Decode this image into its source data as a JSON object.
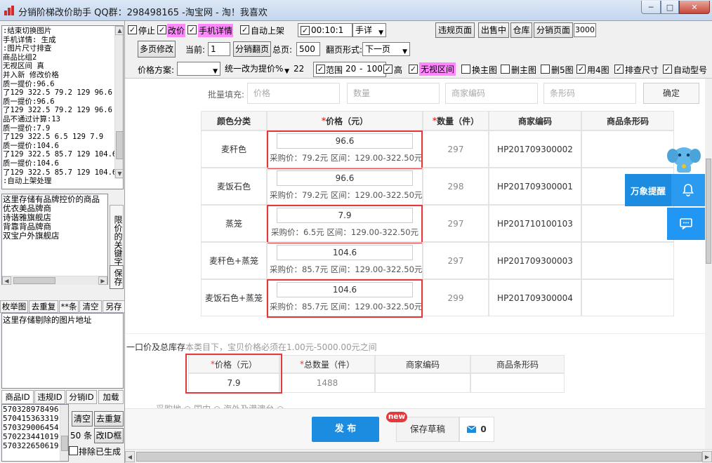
{
  "window": {
    "title": "分销阶梯改价助手 QQ群：298498165 -淘宝网 - 淘！我喜欢",
    "min": "─",
    "max": "□",
    "close": "✕"
  },
  "colors": {
    "accent_blue": "#2196f3",
    "pink": "#ff88ff",
    "red": "#e4393c"
  },
  "left": {
    "log_lines": [
      ":结束切换图片",
      "手机详情: 生成",
      ":图片尺寸排查",
      "商品比组2",
      "无视区间 真",
      "并入新 修改价格",
      "质一提价:96.6",
      "了129 322.5 79.2 129 96.6",
      "质一提价:96.6",
      "了129 322.5 79.2 129 96.6",
      "品不通过计算:13",
      "质一提价:7.9",
      "了129 322.5 6.5 129 7.9",
      "质一提价:104.6",
      "了129 322.5 85.7 129 104.6",
      "质一提价:104.6",
      "了129 322.5 85.7 129 104.6",
      ":自动上架处理"
    ],
    "keyword_lines": [
      "这里存储有品牌控价的商品",
      "优衣美品牌商",
      "诗谐雅旗舰店",
      "背靠背品牌商",
      "双宝户外旗舰店"
    ],
    "keyword_label": "限价的关键字",
    "save_label": "保存",
    "tabs1": [
      "枚举图",
      "去重复",
      "**条",
      "清空",
      "另存"
    ],
    "delpic_text": "这里存储剔除的图片地址",
    "tabs2": [
      "商品ID",
      "违规ID",
      "分销ID",
      "加载"
    ],
    "ids": [
      "570328978496",
      "570415363319",
      "570329006454",
      "570223441019",
      "570322650619"
    ],
    "clear_label": "清空",
    "dedupe_label": "去重复",
    "count_label": "50 条",
    "edit_id_label": "改ID框",
    "exclude_label": "排除已生成"
  },
  "toolbar1": {
    "stop": "停止",
    "change_price": "改价",
    "mobile_detail": "手机详情",
    "auto_list": "自动上架",
    "time_value": "00:10:1",
    "detail_mode": "手详",
    "violation_page": "违规页面",
    "sale_page": "出售中",
    "warehouse": "仓库",
    "distribution_page": "分销页面",
    "distribution_value": "3000"
  },
  "toolbar2": {
    "multi_edit": "多页修改",
    "current_label": "当前:",
    "current_value": "1",
    "distribution_flip": "分销翻页",
    "total_label": "总页:",
    "total_value": "500",
    "flip_label": "翻页形式:",
    "flip_value": "下一页"
  },
  "toolbar3": {
    "price_plan_label": "价格方案:",
    "price_plan_value": "",
    "unify_value": "统一改为提价%",
    "unify_number": "22",
    "range_label": "范围",
    "range_min": "20",
    "range_sep": "-",
    "range_max": "100",
    "high_label": "高",
    "ignore_range": "无视区间",
    "change_main": "换主图",
    "delete_main": "删主图",
    "delete_5": "删5图",
    "use_4": "用4图",
    "check_size": "排查尺寸",
    "auto_model": "自动型号"
  },
  "batch": {
    "label": "批量填充:",
    "price_ph": "价格",
    "qty_ph": "数量",
    "code_ph": "商家编码",
    "barcode_ph": "条形码",
    "confirm": "确定"
  },
  "sku_table": {
    "headers": {
      "color": "颜色分类",
      "price": "价格（元）",
      "qty": "数量（件）",
      "code": "商家编码",
      "barcode": "商品条形码"
    },
    "rows": [
      {
        "color": "麦秆色",
        "price": "96.6",
        "sub": "采购价：79.2元 区间：129.00-322.50元",
        "qty": "297",
        "code": "HP201709300002",
        "highlighted": true
      },
      {
        "color": "麦饭石色",
        "price": "96.6",
        "sub": "采购价：79.2元 区间：129.00-322.50元",
        "qty": "298",
        "code": "HP201709300001",
        "highlighted": false
      },
      {
        "color": "蒸笼",
        "price": "7.9",
        "sub": "采购价：6.5元 区间：129.00-322.50元",
        "qty": "297",
        "code": "HP201710100103",
        "highlighted": true
      },
      {
        "color": "麦秆色+蒸笼",
        "price": "104.6",
        "sub": "采购价：85.7元 区间：129.00-322.50元",
        "qty": "297",
        "code": "HP201709300003",
        "highlighted": false
      },
      {
        "color": "麦饭石色+蒸笼",
        "price": "104.6",
        "sub": "采购价：85.7元 区间：129.00-322.50元",
        "qty": "299",
        "code": "HP201709300004",
        "highlighted": true
      }
    ]
  },
  "price_section": {
    "label": "一口价及总库存",
    "note": "本类目下，宝贝价格必须在1.00元-5000.00元之间"
  },
  "summary_table": {
    "h_price": "价格（元）",
    "h_total": "总数量（件）",
    "h_code": "商家编码",
    "h_barcode": "商品条形码",
    "price": "7.9",
    "total": "1488"
  },
  "partial_row": "采购地  ○ 国内  ○ 海外及港澳台 ○",
  "float": {
    "tip": "万象提醒"
  },
  "footer": {
    "publish": "发 布",
    "draft": "保存草稿",
    "new_badge": "new",
    "mail_count": "0"
  }
}
